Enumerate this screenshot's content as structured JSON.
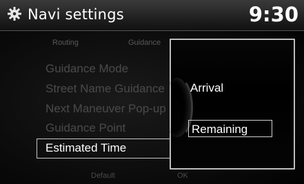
{
  "header": {
    "title": "Navi settings",
    "clock": "9:30",
    "icon": "gear-icon"
  },
  "tabs": [
    {
      "label": "Routing"
    },
    {
      "label": "Guidance"
    }
  ],
  "menu": {
    "items": [
      {
        "label": "Guidance Mode"
      },
      {
        "label": "Street Name Guidance"
      },
      {
        "label": "Next Maneuver Pop-up"
      },
      {
        "label": "Guidance Point"
      }
    ],
    "selected_label": "Estimated Time"
  },
  "bottom": {
    "default_label": "Default",
    "ok_label": "OK"
  },
  "popup": {
    "options": [
      {
        "label": "Arrival"
      },
      {
        "label": "Remaining"
      }
    ],
    "selected_index": 1
  },
  "colors": {
    "background": "#000000",
    "text_active": "#ffffff",
    "text_dimmed": "#474747",
    "border": "#c8c8c8"
  }
}
